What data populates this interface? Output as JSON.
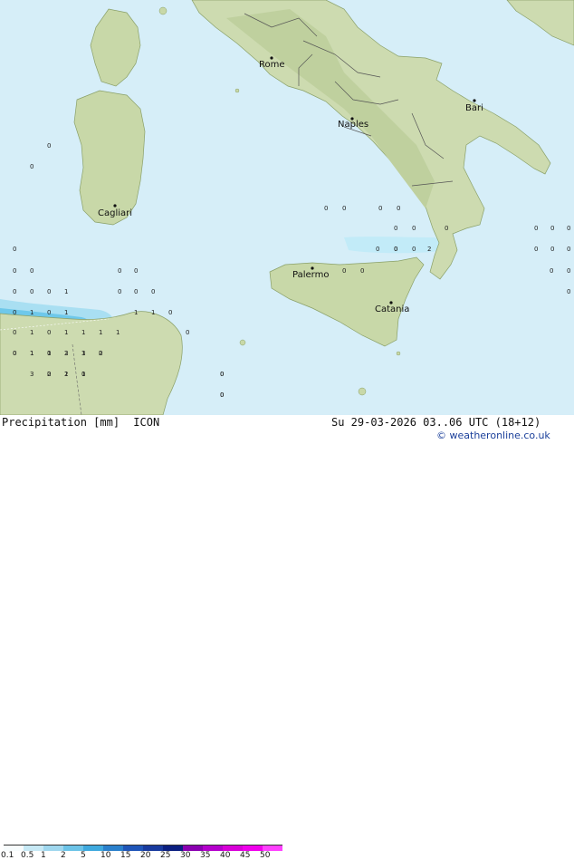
{
  "legend": {
    "title": "Precipitation [mm]",
    "model": "ICON",
    "datetime": "Su 29-03-2026 03..06 UTC (18+12)",
    "brand": "© weatheronline.co.uk",
    "ticks": [
      "0.1",
      "0.5",
      "1",
      "2",
      "5",
      "10",
      "15",
      "20",
      "25",
      "30",
      "35",
      "40",
      "45",
      "50"
    ],
    "colors": [
      "#f7fcfd",
      "#c7e9f5",
      "#9fd7ee",
      "#6cc3e7",
      "#3fa9de",
      "#2a80cc",
      "#1f55b8",
      "#183a9e",
      "#0b1f80",
      "#8a00b0",
      "#b400cc",
      "#d800d8",
      "#f000ec",
      "#ff40ff"
    ]
  },
  "cities": [
    {
      "name": "Rome"
    },
    {
      "name": "Naples"
    },
    {
      "name": "Bari"
    },
    {
      "name": "Cagliari"
    },
    {
      "name": "Palermo"
    },
    {
      "name": "Catania"
    }
  ],
  "values": [
    "0",
    "0",
    "0",
    "0",
    "0",
    "0",
    "0",
    "0",
    "0",
    "0",
    "0",
    "0",
    "0",
    "0",
    "0",
    "0",
    "0",
    "0",
    "0",
    "0",
    "0",
    "0",
    "0",
    "0",
    "0",
    "0",
    "0",
    "0",
    "2",
    "0",
    "0",
    "0",
    "0",
    "1",
    "0",
    "0",
    "0",
    "0",
    "1",
    "0",
    "1",
    "1",
    "1",
    "0",
    "0",
    "1",
    "0",
    "1",
    "1",
    "1",
    "1",
    "0",
    "0",
    "1",
    "0",
    "3",
    "3",
    "2",
    "3",
    "2",
    "2",
    "1",
    "0",
    "0",
    "0",
    "1",
    "1",
    "2",
    "1",
    "0",
    "0",
    "1",
    "0",
    "0",
    "0"
  ]
}
